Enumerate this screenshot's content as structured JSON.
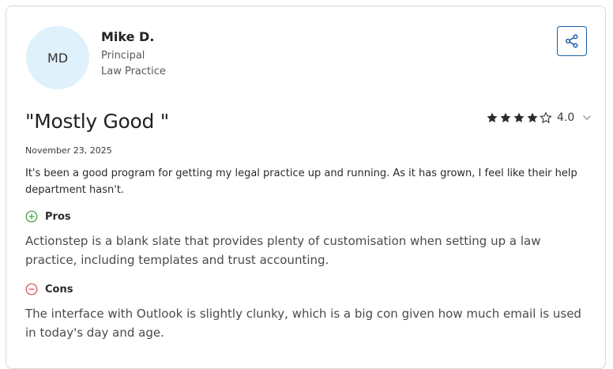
{
  "reviewer": {
    "initials": "MD",
    "name": "Mike D.",
    "role": "Principal",
    "industry": "Law Practice"
  },
  "review": {
    "title": "\"Mostly Good \"",
    "rating": 4.0,
    "rating_label": "4.0",
    "date": "November 23, 2025",
    "summary": "It's been a good program for getting my legal practice up and running. As it has grown, I feel like their help department hasn't.",
    "pros_label": "Pros",
    "pros_text": "Actionstep is a blank slate that provides plenty of customisation when setting up a law practice, including templates and trust accounting.",
    "cons_label": "Cons",
    "cons_text": "The interface with Outlook is slightly clunky, which is a big con given how much email is used in today's day and age."
  },
  "icons": {
    "share": "share-icon",
    "star": "star-icon",
    "chevron": "chevron-down-icon",
    "pros": "plus-circle-icon",
    "cons": "minus-circle-icon"
  },
  "colors": {
    "share_border": "#1a5ea8",
    "avatar_bg": "#dff1fb",
    "pros_green": "#3c9a3c",
    "cons_red": "#d24b4b",
    "star": "#2b2b2b"
  }
}
